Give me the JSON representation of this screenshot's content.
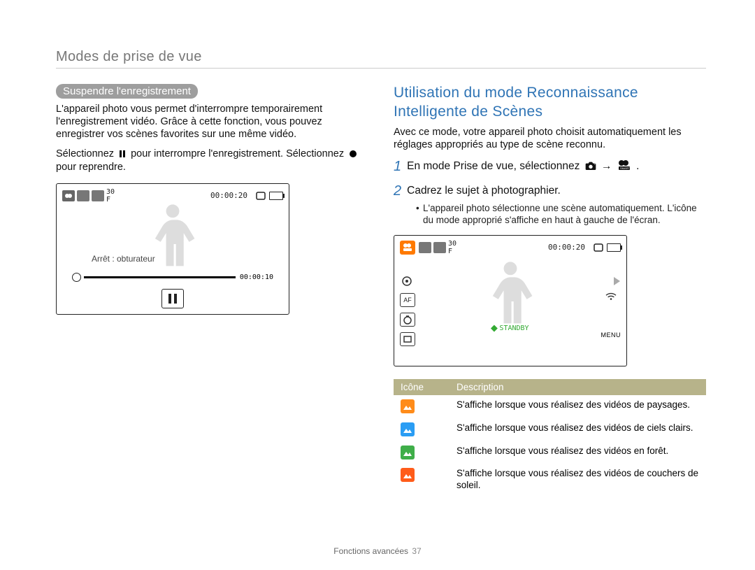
{
  "header": "Modes de prise de vue",
  "left": {
    "pill": "Suspendre l'enregistrement",
    "p1": "L'appareil photo vous permet d'interrompre temporairement l'enregistrement vidéo. Grâce à cette fonction, vous pouvez enregistrer vos scènes favorites sur une même vidéo.",
    "p2a": "Sélectionnez ",
    "p2b": " pour interrompre l'enregistrement. Sélectionnez ",
    "p2c": " pour reprendre.",
    "lcd": {
      "top_time": "00:00:20",
      "label": "Arrêt : obturateur",
      "bar_time": "00:00:10"
    }
  },
  "right": {
    "title": "Utilisation du mode Reconnaissance Intelligente de Scènes",
    "intro": "Avec ce mode, votre appareil photo choisit automatiquement les réglages appropriés au type de scène reconnu.",
    "step1": "En mode Prise de vue, sélectionnez ",
    "step1b": " → ",
    "step1c": ".",
    "step2": "Cadrez le sujet à photographier.",
    "bullet": "L'appareil photo sélectionne une scène automatiquement. L'icône du mode approprié s'affiche en haut à gauche de l'écran.",
    "lcd2": {
      "top_time": "00:00:20",
      "standby": "STANDBY",
      "af": "AF",
      "menu": "MENU"
    },
    "table": {
      "h1": "Icône",
      "h2": "Description",
      "rows": [
        {
          "color": "#ff8c1a",
          "desc": "S'affiche lorsque vous réalisez des vidéos de paysages."
        },
        {
          "color": "#2a9df4",
          "desc": "S'affiche lorsque vous réalisez des vidéos de ciels clairs."
        },
        {
          "color": "#3fae49",
          "desc": "S'affiche lorsque vous réalisez des vidéos en forêt."
        },
        {
          "color": "#ff5c1a",
          "desc": "S'affiche lorsque vous réalisez des vidéos de couchers de soleil."
        }
      ]
    }
  },
  "footer": {
    "label": "Fonctions avancées",
    "page": "37"
  },
  "step_numbers": {
    "one": "1",
    "two": "2"
  },
  "icon_names": {
    "pause": "pause-icon",
    "record": "record-icon",
    "camera": "camera-icon",
    "smart": "smart-video-icon",
    "af": "af-icon",
    "timer_off": "timer-off-icon",
    "display": "display-icon",
    "wifi": "wifi-icon",
    "menu": "menu-icon",
    "battery": "battery-icon",
    "triangle": "play-triangle-icon",
    "landscape": "landscape-icon"
  }
}
